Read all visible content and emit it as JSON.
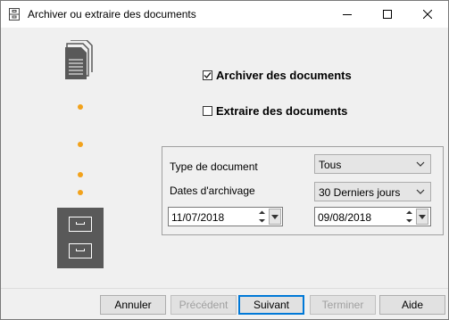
{
  "window": {
    "title": "Archiver ou extraire des documents"
  },
  "options": {
    "archive_label": "Archiver des documents",
    "archive_checked": true,
    "extract_label": "Extraire des documents",
    "extract_checked": false
  },
  "filters": {
    "doc_type_label": "Type de document",
    "doc_type_value": "Tous",
    "dates_label": "Dates d'archivage",
    "dates_value": "30 Derniers jours",
    "date_from": "11/07/2018",
    "date_to": "09/08/2018"
  },
  "buttons": {
    "cancel": "Annuler",
    "previous": "Précédent",
    "next": "Suivant",
    "finish": "Terminer",
    "help": "Aide"
  },
  "colors": {
    "accent": "#0078d7",
    "dots": "#f2a21b",
    "icon_gray": "#595959"
  },
  "icons": [
    "app-icon",
    "document-icon",
    "archive-cabinet-icon",
    "checkmark-icon",
    "chevron-down-icon",
    "spin-up-icon",
    "spin-down-icon"
  ]
}
